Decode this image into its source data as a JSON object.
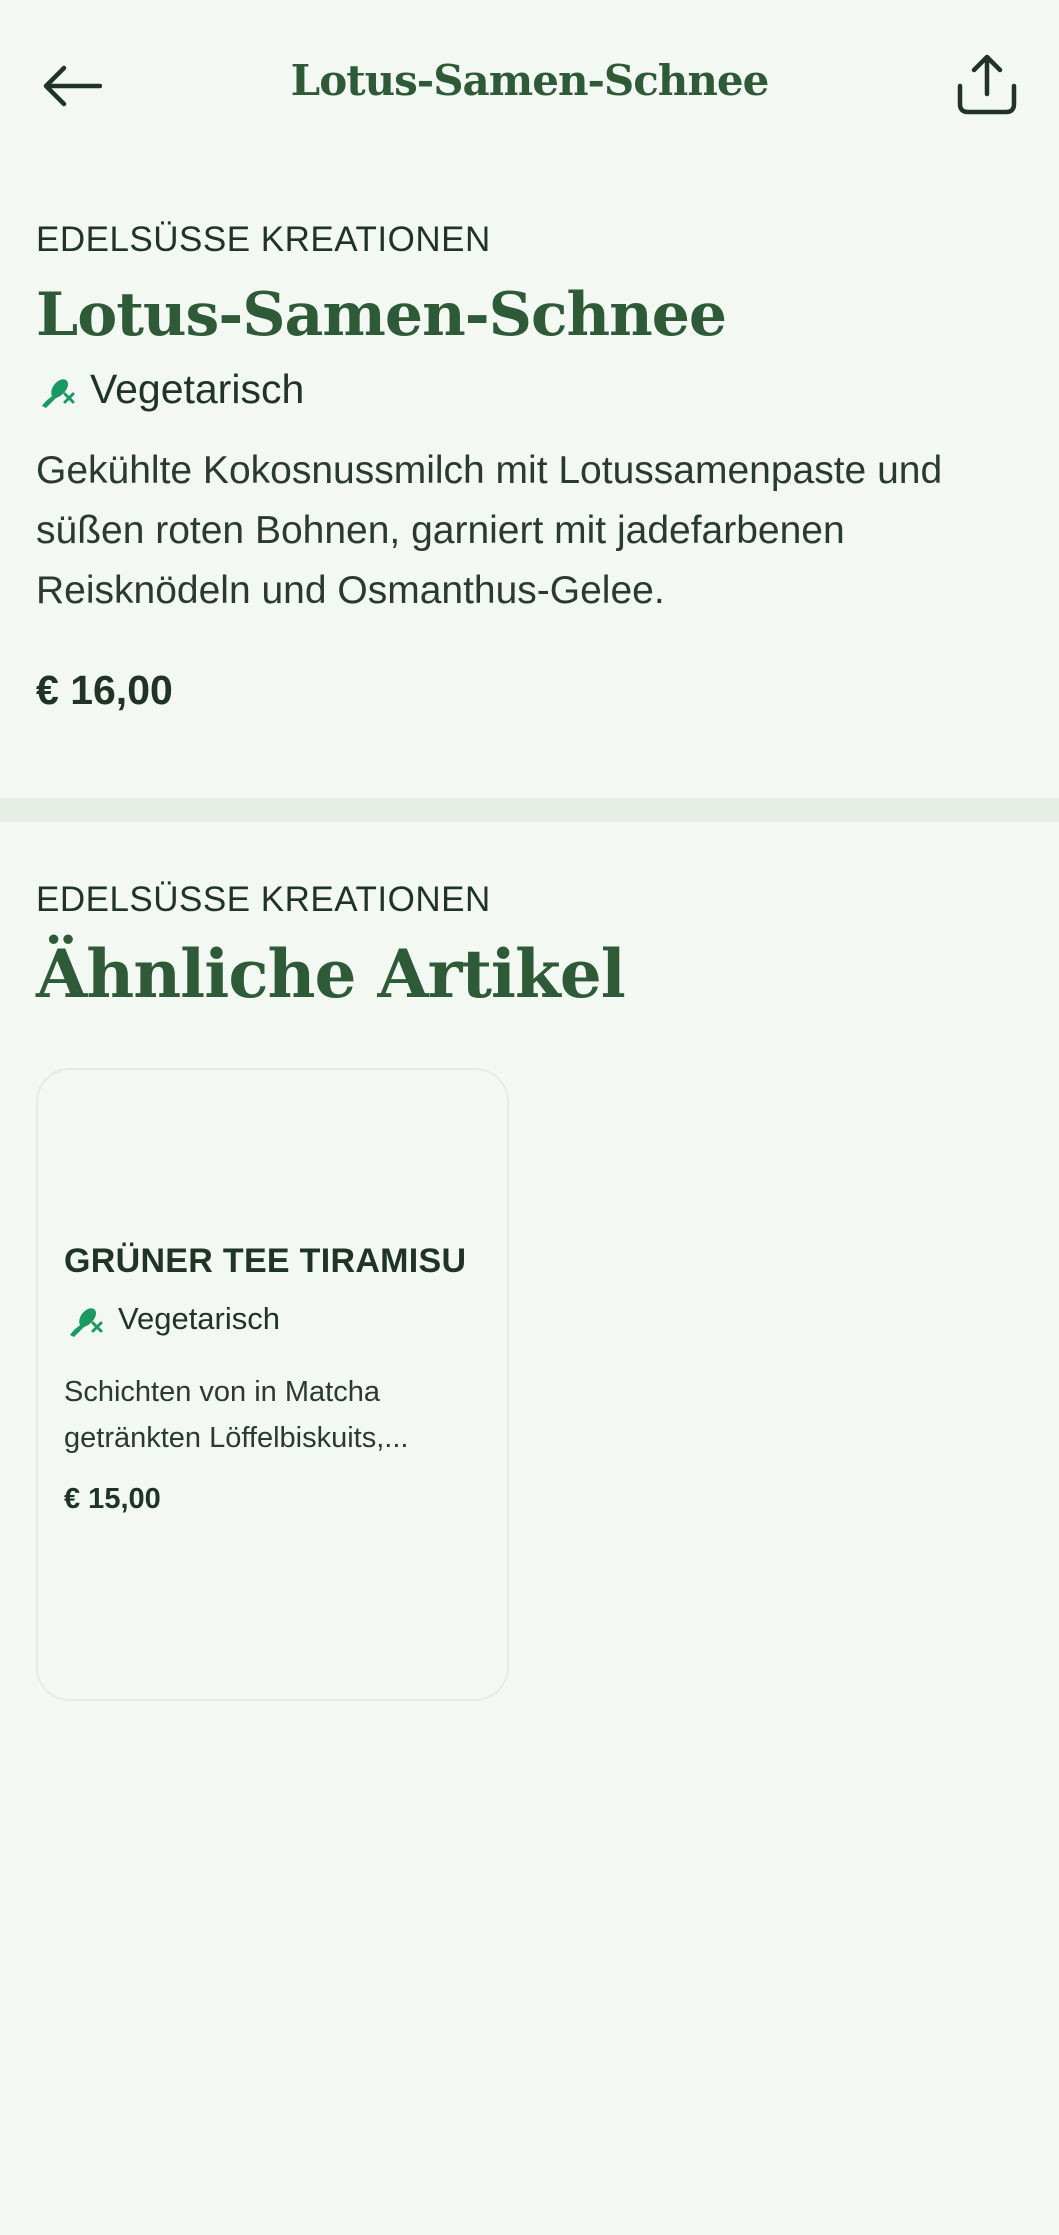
{
  "header": {
    "title": "Lotus-Samen-Schnee",
    "back_icon": "arrow-left-icon",
    "share_icon": "share-icon"
  },
  "product": {
    "category": "EDELSÜSSE KREATIONEN",
    "name": "Lotus-Samen-Schnee",
    "diet_label": "Vegetarisch",
    "diet_icon": "vegetarian-icon",
    "description": "Gekühlte Kokosnussmilch mit Lotussamenpaste und süßen roten Bohnen, garniert mit jadefarbenen Reisknödeln und Osmanthus-Gelee.",
    "price": "€ 16,00"
  },
  "similar": {
    "category": "EDELSÜSSE KREATIONEN",
    "title": "Ähnliche Artikel",
    "items": [
      {
        "name": "GRÜNER TEE TIRAMISU",
        "diet_label": "Vegetarisch",
        "diet_icon": "vegetarian-icon",
        "description": "Schichten von in Matcha getränkten Löffelbiskuits,...",
        "price": "€ 15,00"
      }
    ]
  },
  "colors": {
    "background": "#f3f8f2",
    "accent_green": "#2e5a38",
    "veg_icon_green": "#1a9a62",
    "divider": "#e7eee6",
    "text": "#1f3326"
  }
}
